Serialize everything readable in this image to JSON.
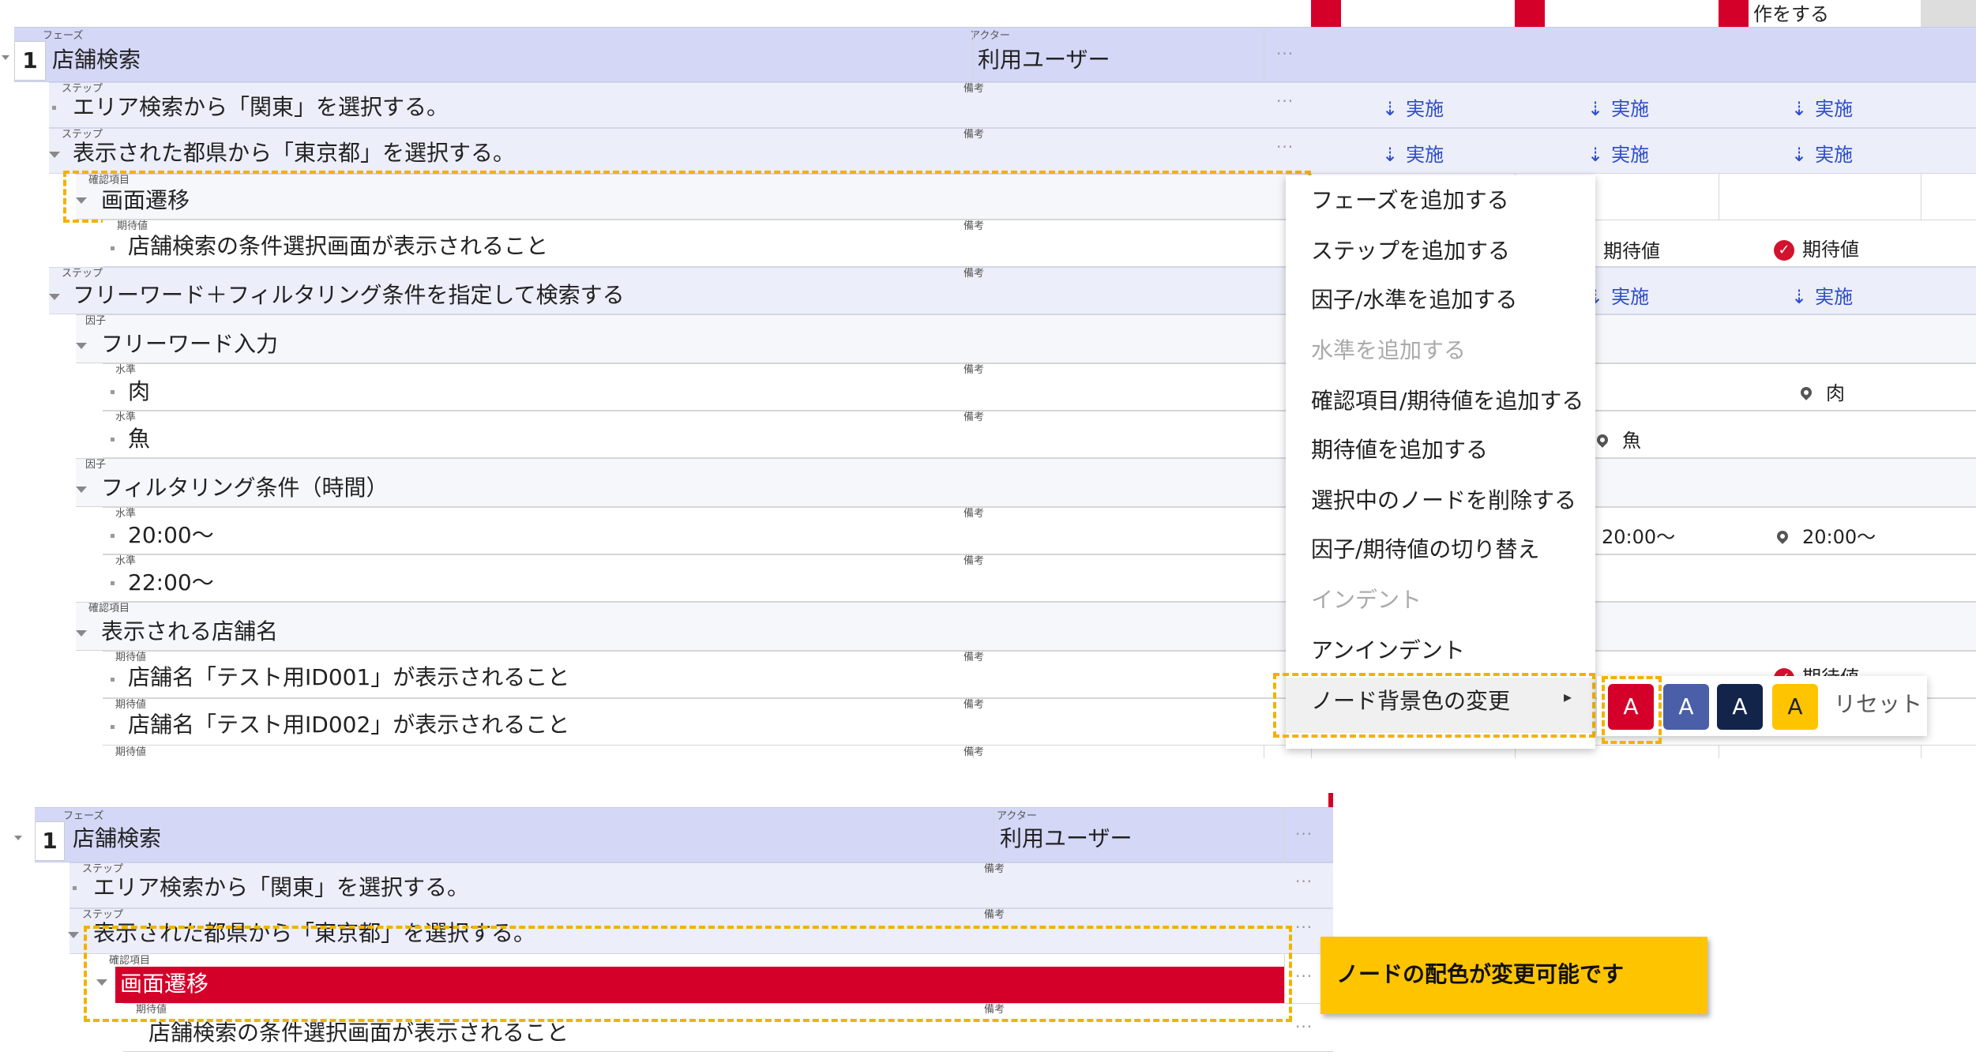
{
  "top": {
    "labels": {
      "phase": "フェーズ",
      "actor": "アクター",
      "step": "ステップ",
      "memo": "備考",
      "check": "確認項目",
      "expect": "期待値",
      "factor": "因子",
      "level": "水準"
    },
    "header_cut_text": "作をする",
    "phase": {
      "num": "1",
      "name": "店舗検索",
      "actor": "利用ユーザー"
    },
    "rows": {
      "step1": "エリア検索から「関東」を選択する。",
      "step2": "表示された都県から「東京都」を選択する。",
      "check1": "画面遷移",
      "expect1": "店舗検索の条件選択画面が表示されること",
      "step3": "フリーワード＋フィルタリング条件を指定して検索する",
      "factor1": "フリーワード入力",
      "level1": "肉",
      "level2": "魚",
      "factor2": "フィルタリング条件（時間）",
      "level3": "20:00〜",
      "level4": "22:00〜",
      "check2": "表示される店舗名",
      "expect2": "店舗名「テスト用ID001」が表示されること",
      "expect3": "店舗名「テスト用ID002」が表示されること"
    },
    "cells": {
      "exec": "実施",
      "expect": "期待値",
      "fish": "魚",
      "meat": "肉",
      "t2000": "20:00〜",
      "partial": "期待値"
    },
    "more": "···"
  },
  "menu": {
    "items": [
      "フェーズを追加する",
      "ステップを追加する",
      "因子/水準を追加する",
      "水準を追加する",
      "確認項目/期待値を追加する",
      "期待値を追加する",
      "選択中のノードを削除する",
      "因子/期待値の切り替え",
      "インデント",
      "アンインデント",
      "ノード背景色の変更"
    ],
    "disabled": [
      3,
      8
    ],
    "arrow": "▸"
  },
  "colors": {
    "swatches": [
      {
        "label": "A",
        "color": "#d4002a"
      },
      {
        "label": "A",
        "color": "#4a5fa8"
      },
      {
        "label": "A",
        "color": "#13244b"
      },
      {
        "label": "A",
        "color": "#ffc400"
      }
    ],
    "reset": "リセット"
  },
  "bottom": {
    "phase": {
      "num": "1",
      "name": "店舗検索",
      "actor": "利用ユーザー"
    },
    "step1": "エリア検索から「関東」を選択する。",
    "step2": "表示された都県から「東京都」を選択する。",
    "check1": "画面遷移",
    "expect1": "店舗検索の条件選択画面が表示されること"
  },
  "callout": "ノードの配色が変更可能です"
}
